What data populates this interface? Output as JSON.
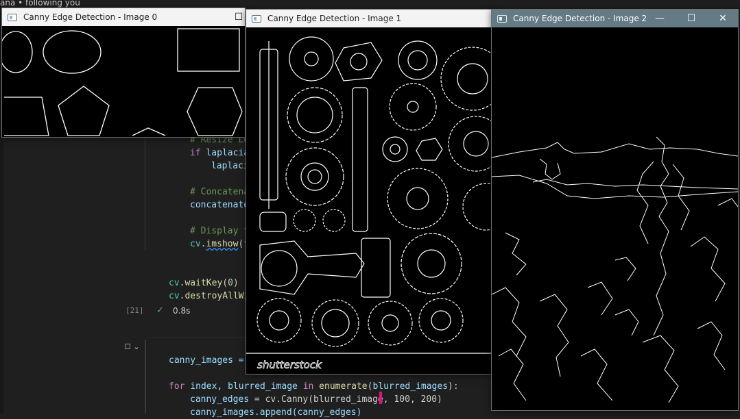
{
  "editor": {
    "notification": "ana  • following you",
    "code_lines": [
      {
        "text": "# Resize Le",
        "kind": "comment"
      },
      {
        "text": "if laplacia",
        "kind": "if"
      },
      {
        "text": "laplaci",
        "kind": "var"
      },
      {
        "text": "# Concatena",
        "kind": "comment"
      },
      {
        "text": "concatenate",
        "kind": "var"
      },
      {
        "text": "# Display t",
        "kind": "comment"
      },
      {
        "text": "cv.imshow(f",
        "kind": "call"
      },
      {
        "text": "cv.waitKey(0)",
        "kind": "call"
      },
      {
        "text": "cv.destroyAllWi",
        "kind": "call"
      }
    ],
    "cell_number": "[21]",
    "exec_time": "0.8s",
    "next_cell": {
      "line1": "canny_images = ",
      "line2_for": "for",
      "line2_var": "index, blurred_image",
      "line2_in": "in",
      "line2_fn": "enumerate",
      "line2_arg": "blurred_images",
      "line3_var": "canny_edges",
      "line3_call": "cv.Canny(blurred_image, 100, 200)",
      "line4": "canny_images.append(canny_edges)"
    }
  },
  "windows": [
    {
      "title": "Canny Edge Detection - Image 0",
      "active": false
    },
    {
      "title": "Canny Edge Detection - Image 1",
      "active": false
    },
    {
      "title": "Canny Edge Detection - Image 2",
      "active": true
    }
  ],
  "window1_watermark": "shutterstock",
  "icons": {
    "minimize": "minimize-icon",
    "maximize": "maximize-icon",
    "close": "close-icon",
    "app": "opencv-window-icon"
  }
}
